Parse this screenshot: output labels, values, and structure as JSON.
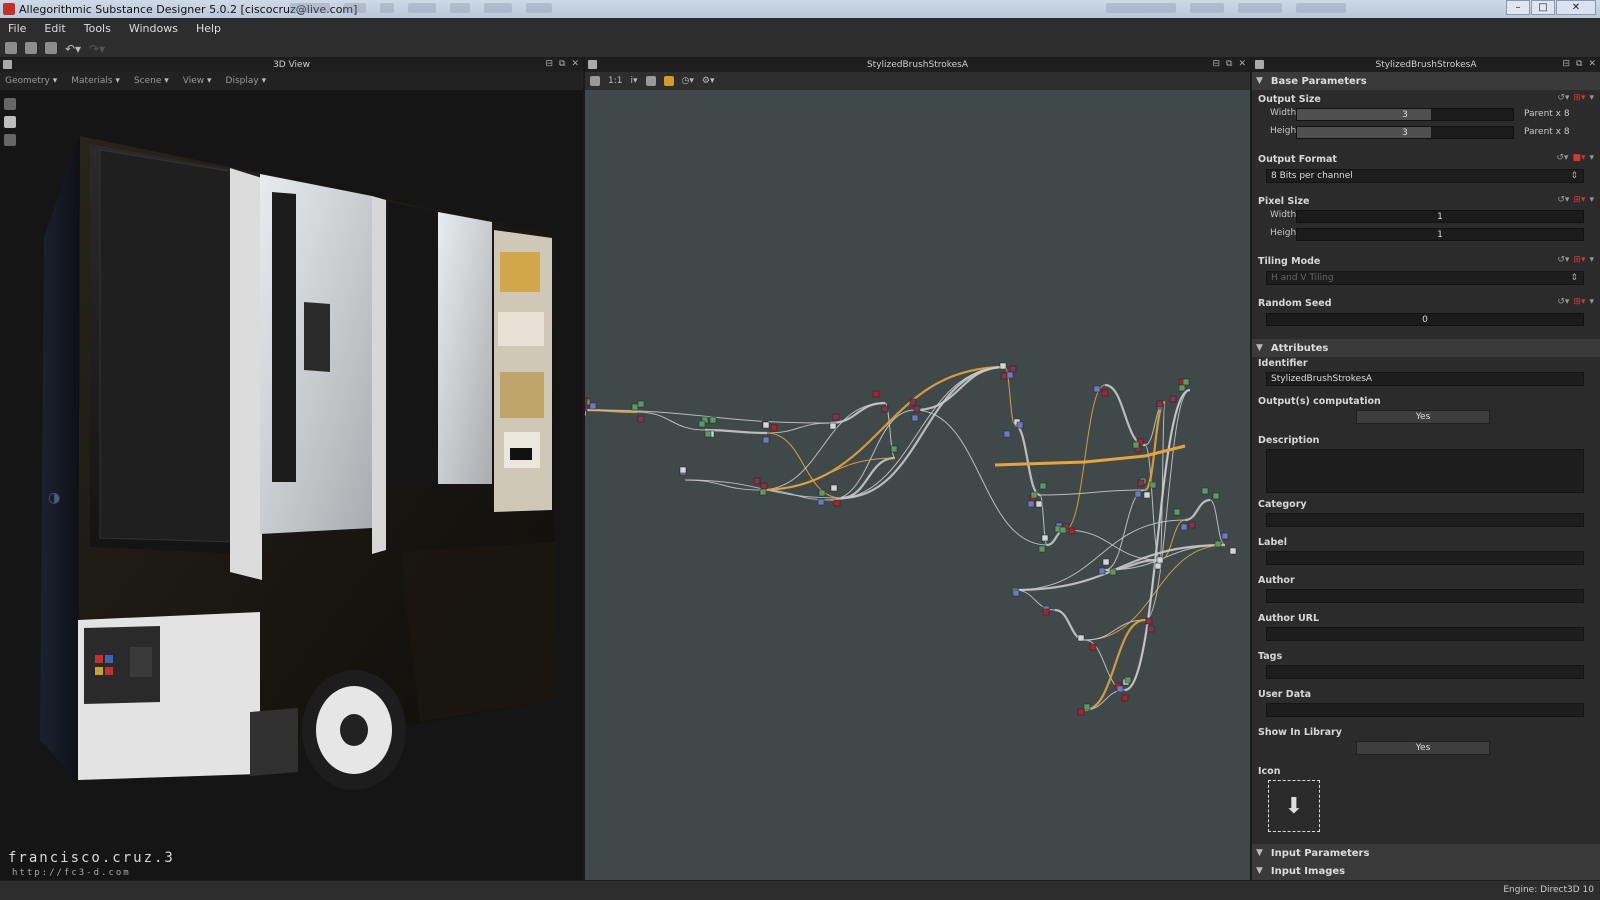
{
  "window": {
    "title": "Allegorithmic Substance Designer 5.0.2 [ciscocruz@live.com]",
    "controls": {
      "minimize": "–",
      "maximize": "□",
      "close": "✕"
    }
  },
  "menu": {
    "file": "File",
    "edit": "Edit",
    "tools": "Tools",
    "windows": "Windows",
    "help": "Help"
  },
  "view3d": {
    "title": "3D View",
    "menus": [
      "Geometry",
      "Materials",
      "Scene",
      "View",
      "Display"
    ],
    "watermark": "francisco.cruz.3",
    "watermark_url": "http://fc3-d.com"
  },
  "graph": {
    "title": "StylizedBrushStrokesA",
    "zoom_label": "1:1"
  },
  "props": {
    "title": "StylizedBrushStrokesA",
    "base_section": "Base Parameters",
    "output_size": {
      "label": "Output Size",
      "width_label": "Width",
      "width_value": "3",
      "width_suffix": "Parent x 8",
      "height_label": "Height",
      "height_value": "3",
      "height_suffix": "Parent x 8",
      "fill_fraction": 0.62
    },
    "output_format": {
      "label": "Output Format",
      "value": "8 Bits per channel"
    },
    "pixel_size": {
      "label": "Pixel Size",
      "width_label": "Width",
      "width_value": "1",
      "height_label": "Height",
      "height_value": "1"
    },
    "tiling_mode": {
      "label": "Tiling Mode",
      "value": "H and V Tiling"
    },
    "random_seed": {
      "label": "Random Seed",
      "value": "0"
    },
    "attributes_section": "Attributes",
    "identifier": {
      "label": "Identifier",
      "value": "StylizedBrushStrokesA"
    },
    "outputs_computation": {
      "label": "Output(s) computation",
      "value": "Yes"
    },
    "description": {
      "label": "Description"
    },
    "category": {
      "label": "Category"
    },
    "label": {
      "label": "Label"
    },
    "author": {
      "label": "Author"
    },
    "author_url": {
      "label": "Author URL"
    },
    "tags": {
      "label": "Tags"
    },
    "user_data": {
      "label": "User Data"
    },
    "show_in_library": {
      "label": "Show In Library",
      "value": "Yes"
    },
    "icon": {
      "label": "Icon"
    },
    "input_parameters_section": "Input Parameters",
    "input_images_section": "Input Images"
  },
  "status": {
    "engine": "Engine: Direct3D 10"
  },
  "colors": {
    "node_red": "#b0202c",
    "node_green": "#5a9a63",
    "node_blue": "#6d79c8",
    "node_gray": "#d5d5d5",
    "link_orange": "#e8a33a",
    "graph_bg": "#40494a"
  }
}
